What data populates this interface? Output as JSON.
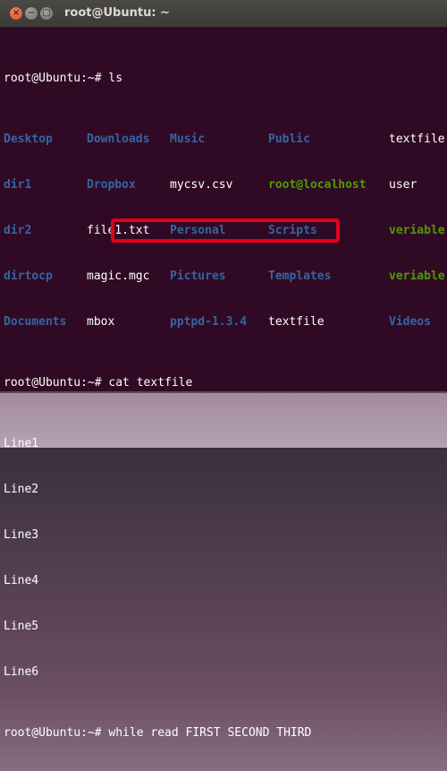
{
  "window": {
    "title": "root@Ubuntu: ~"
  },
  "colors": {
    "background": "#300a24",
    "directory": "#3465a4",
    "executable": "#4e9a06",
    "text": "#ffffff",
    "highlight": "#e4001b"
  },
  "terminal": {
    "cmd1": {
      "prompt": "root@Ubuntu:~#",
      "command": " ls"
    },
    "ls_rows": [
      [
        "Desktop",
        "Downloads",
        "Music",
        "Public",
        "textfile"
      ],
      [
        "dir1",
        "Dropbox",
        "mycsv.csv",
        "root@localhost",
        "user"
      ],
      [
        "dir2",
        "file1.txt",
        "Personal",
        "Scripts",
        "veriable"
      ],
      [
        "dirtocp",
        "magic.mgc",
        "Pictures",
        "Templates",
        "veriable"
      ],
      [
        "Documents",
        "mbox",
        "pptpd-1.3.4",
        "textfile",
        "Videos"
      ]
    ],
    "cmd2": {
      "prompt": "root@Ubuntu:~#",
      "command": " cat textfile"
    },
    "output": [
      "Line1",
      "Line2",
      "Line3",
      "Line4",
      "Line5",
      "Line6"
    ],
    "cmd3": {
      "prompt": "root@Ubuntu:~#",
      "command": " while read FIRST SECOND THIRD"
    }
  }
}
